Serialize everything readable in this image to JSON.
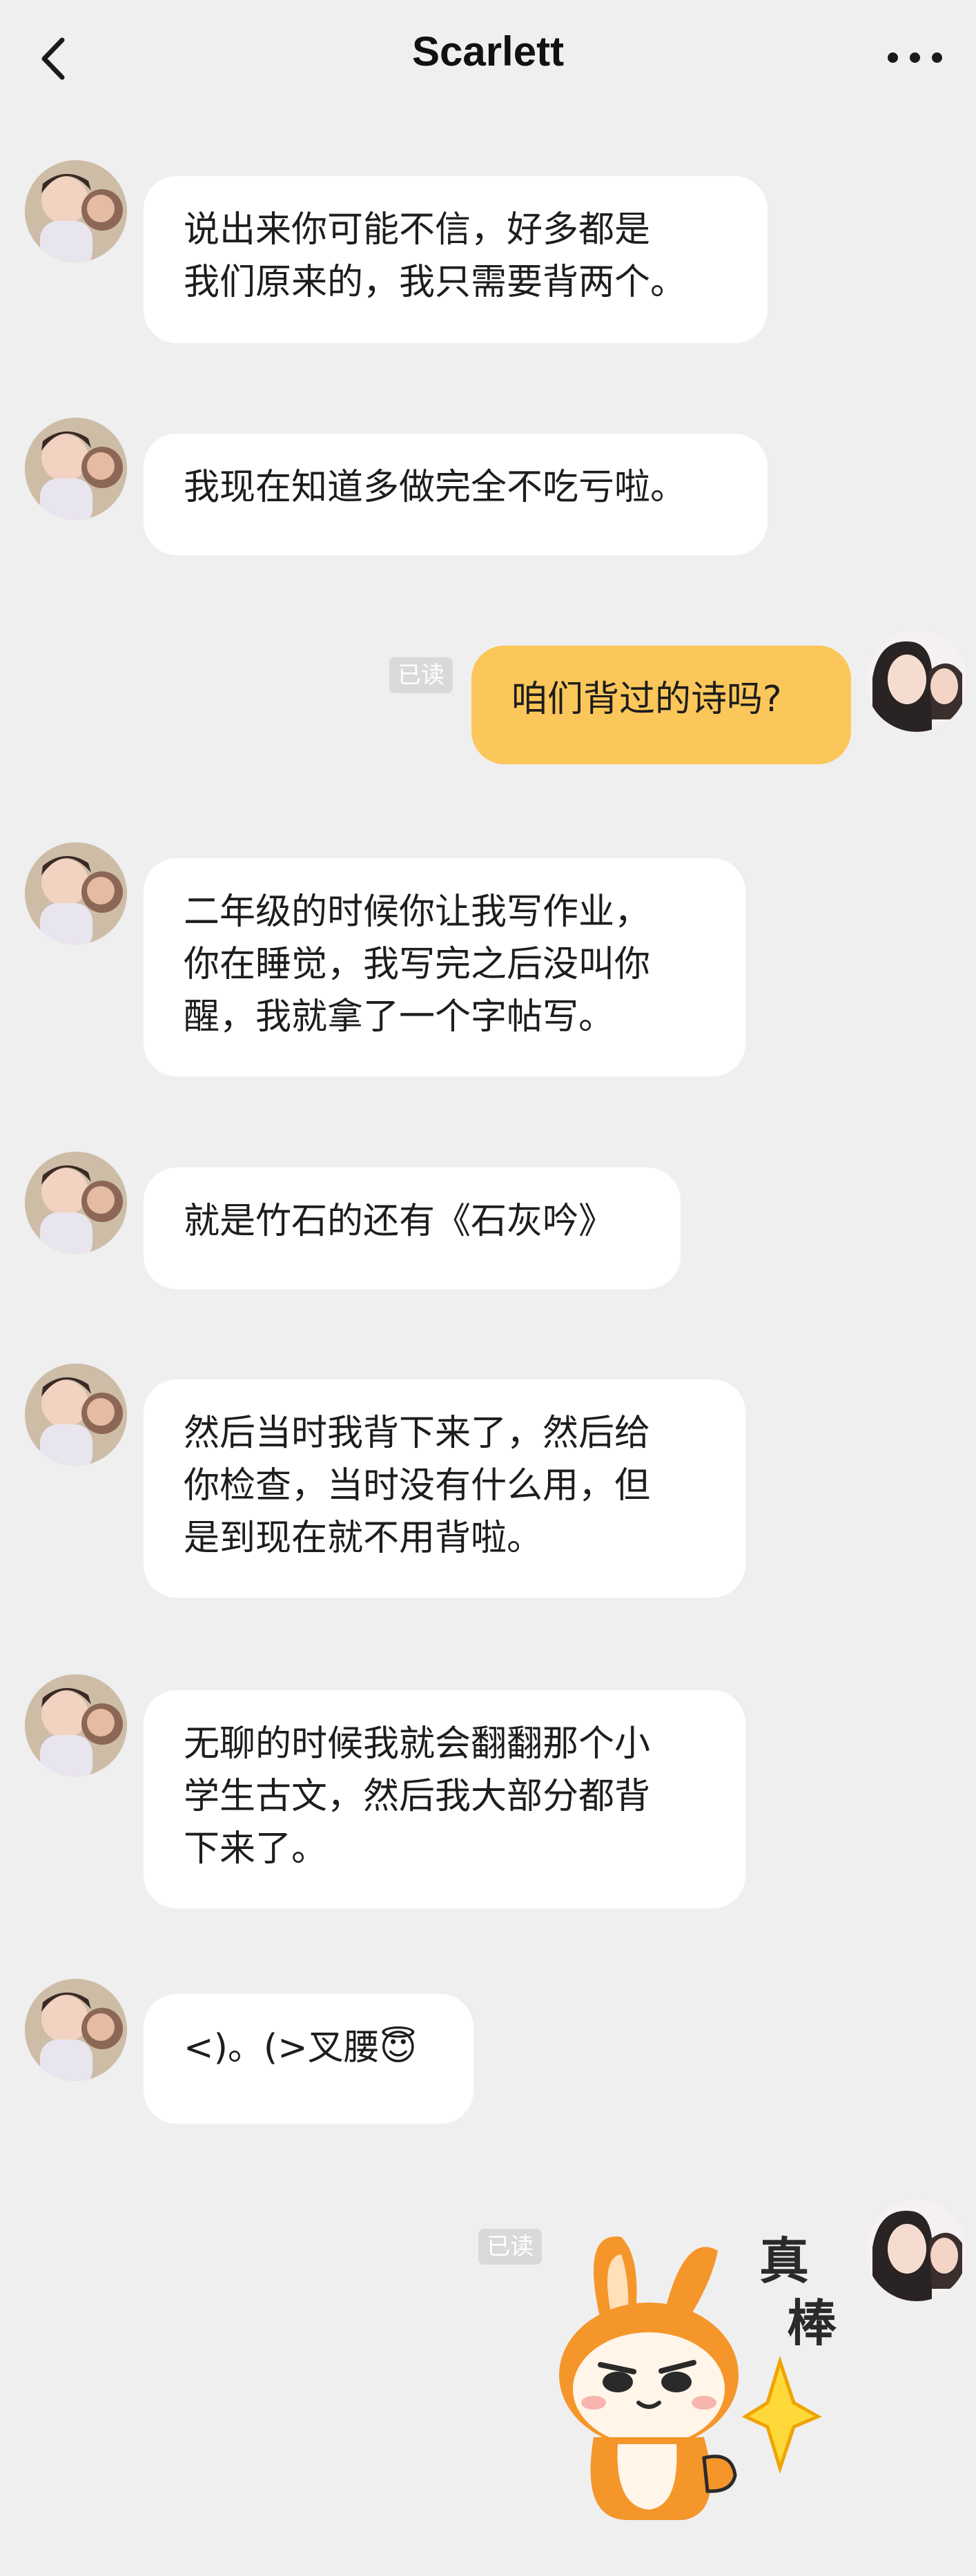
{
  "header": {
    "title": "Scarlett"
  },
  "messages": [
    {
      "lines": [
        "说出来你可能不信，好多都是",
        "我们原来的，我只需要背两个。"
      ]
    },
    {
      "lines": [
        "我现在知道多做完全不吃亏啦。"
      ]
    },
    {
      "lines": [
        "咱们背过的诗吗?"
      ],
      "read": "已读"
    },
    {
      "lines": [
        "二年级的时候你让我写作业，",
        "你在睡觉，我写完之后没叫你",
        "醒，我就拿了一个字帖写。"
      ]
    },
    {
      "lines": [
        "就是竹石的还有《石灰吟》"
      ]
    },
    {
      "lines": [
        "然后当时我背下来了，然后给",
        "你检查，当时没有什么用，但",
        "是到现在就不用背啦。"
      ]
    },
    {
      "lines": [
        "无聊的时候我就会翻翻那个小",
        "学生古文，然后我大部分都背",
        "下来了。"
      ]
    },
    {
      "lines": [
        "<)。(>叉腰"
      ],
      "emoji": "😇"
    }
  ],
  "sticker": {
    "read": "已读",
    "text": [
      "真",
      "棒"
    ]
  },
  "colors": {
    "background": "#efeff0",
    "my_bubble": "#fbc75a",
    "their_bubble": "#ffffff"
  }
}
